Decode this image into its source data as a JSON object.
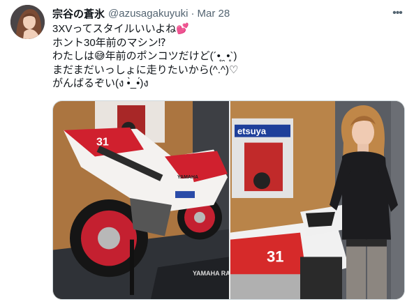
{
  "tweet": {
    "display_name": "宗谷の蒼氷",
    "handle": "@azusagakuyuki",
    "separator": "·",
    "date": "Mar 28",
    "more_label": "•••",
    "text_lines": [
      "3XVってスタイルいいよね💕",
      "ホント30年前のマシン⁉",
      "わたしは😅年前のポンコツだけど(´•̥ ̯ •̥`)",
      "まだまだいっしょに走りたいから(^.^)♡",
      "がんばるぞい(ง •̀_•́)ง"
    ]
  },
  "media": {
    "left_photo": {
      "bike_number": "31",
      "brand_text": "YAMAHA",
      "mat_text": "YAMAHA RACING"
    },
    "right_photo": {
      "poster_text": "etsuya",
      "bike_number": "31"
    }
  },
  "colors": {
    "text_primary": "#0f1419",
    "text_secondary": "#536471",
    "border": "#cfd9de",
    "bike_red": "#d0202e",
    "bike_white": "#f4f2f0"
  }
}
